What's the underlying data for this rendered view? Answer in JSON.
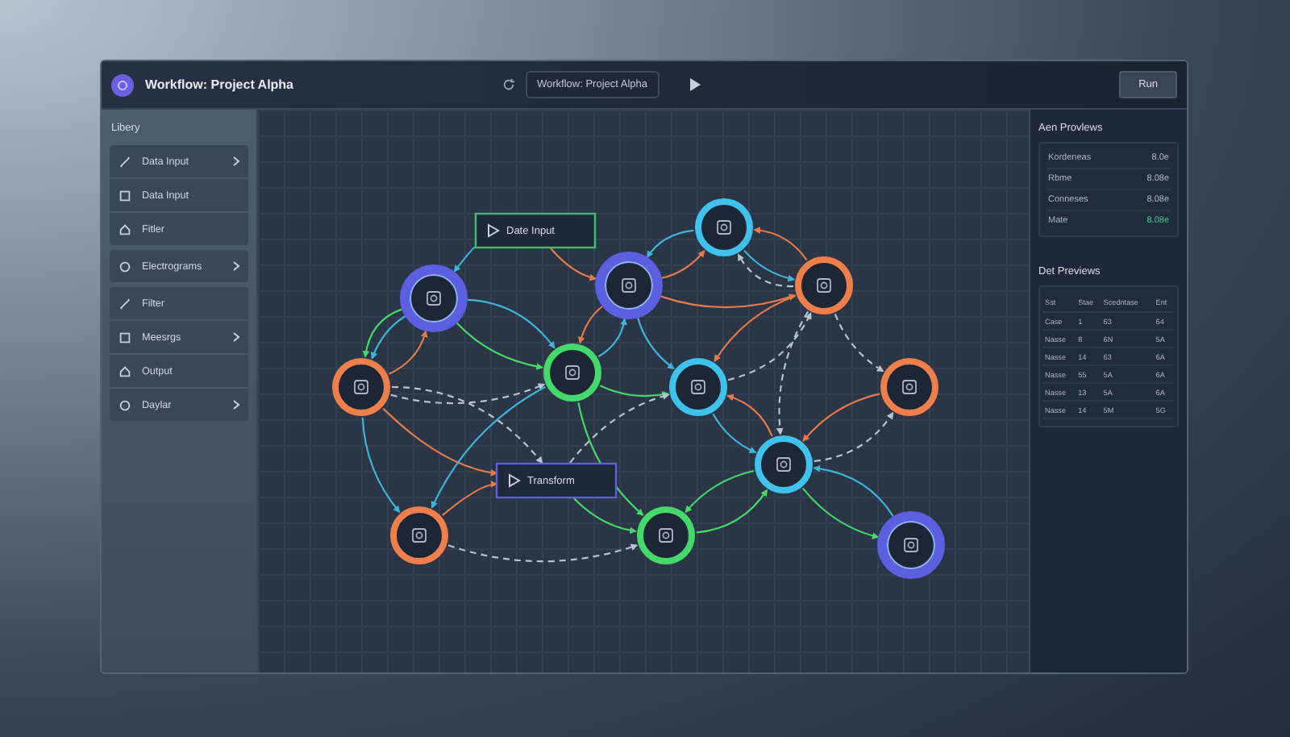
{
  "window": {
    "title": "Workflow: Project Alpha"
  },
  "toolbar": {
    "workflow": "Workflow: Project Alpha",
    "run": "Run"
  },
  "sidebar": {
    "title": "Libery",
    "groups": [
      {
        "items": [
          {
            "label": "Data Input",
            "expandable": true
          },
          {
            "label": "Data Input",
            "expandable": false
          },
          {
            "label": "Fitler",
            "expandable": false
          }
        ]
      },
      {
        "items": [
          {
            "label": "Electrograms",
            "expandable": true
          }
        ]
      },
      {
        "items": [
          {
            "label": "Filter",
            "expandable": false
          },
          {
            "label": "Meesrgs",
            "expandable": true
          },
          {
            "label": "Output",
            "expandable": false
          },
          {
            "label": "Daylar",
            "expandable": true
          }
        ]
      }
    ]
  },
  "canvas": {
    "nodes": [
      {
        "kind": "block",
        "label": "Date Input",
        "color": "#3fbf6a"
      },
      {
        "kind": "circle",
        "color": "#5b5fe0"
      },
      {
        "kind": "circle",
        "color": "#5b5fe0"
      },
      {
        "kind": "circle",
        "color": "#3fc3ec"
      },
      {
        "kind": "circle",
        "color": "#ee7f4b"
      },
      {
        "kind": "circle",
        "color": "#ee7f4b"
      },
      {
        "kind": "circle",
        "color": "#45d86a"
      },
      {
        "kind": "circle",
        "color": "#3fc3ec"
      },
      {
        "kind": "circle",
        "color": "#ee7f4b"
      },
      {
        "kind": "circle",
        "color": "#3fc3ec"
      },
      {
        "kind": "block",
        "label": "Transform",
        "color": "#5b5fe0"
      },
      {
        "kind": "circle",
        "color": "#ee7f4b"
      },
      {
        "kind": "circle",
        "color": "#45d86a"
      },
      {
        "kind": "circle",
        "color": "#5b5fe0"
      }
    ],
    "edges": [
      {
        "color": "#3fb4d8",
        "dashed": false
      },
      {
        "color": "#e67a4a",
        "dashed": false
      },
      {
        "color": "#3fb4d8",
        "dashed": false
      },
      {
        "color": "#e67a4a",
        "dashed": false
      },
      {
        "color": "#45d86a",
        "dashed": false
      },
      {
        "color": "#45d86a",
        "dashed": false
      },
      {
        "color": "#3fb4d8",
        "dashed": false
      },
      {
        "color": "#e67a4a",
        "dashed": false
      },
      {
        "color": "#3fb4d8",
        "dashed": false
      },
      {
        "color": "#e67a4a",
        "dashed": false
      },
      {
        "color": "#e67a4a",
        "dashed": false
      },
      {
        "color": "#3fb4d8",
        "dashed": false
      },
      {
        "color": "#3fb4d8",
        "dashed": false
      },
      {
        "color": "#3fb4d8",
        "dashed": false
      },
      {
        "color": "#e67a4a",
        "dashed": false
      },
      {
        "color": "#b8c2d0",
        "dashed": true
      },
      {
        "color": "#e67a4a",
        "dashed": false
      },
      {
        "color": "#b8c2d0",
        "dashed": true
      },
      {
        "color": "#b8c2d0",
        "dashed": true
      },
      {
        "color": "#b8c2d0",
        "dashed": true
      },
      {
        "color": "#b8c2d0",
        "dashed": true
      },
      {
        "color": "#e67a4a",
        "dashed": false
      },
      {
        "color": "#b8c2d0",
        "dashed": true
      },
      {
        "color": "#3fb4d8",
        "dashed": false
      },
      {
        "color": "#3fb4d8",
        "dashed": false
      },
      {
        "color": "#45d86a",
        "dashed": false
      },
      {
        "color": "#45d86a",
        "dashed": false
      },
      {
        "color": "#b8c2d0",
        "dashed": true
      },
      {
        "color": "#45d86a",
        "dashed": false
      },
      {
        "color": "#e67a4a",
        "dashed": false
      },
      {
        "color": "#b8c2d0",
        "dashed": true
      },
      {
        "color": "#3fb4d8",
        "dashed": false
      },
      {
        "color": "#e67a4a",
        "dashed": false
      },
      {
        "color": "#e67a4a",
        "dashed": false
      },
      {
        "color": "#b8c2d0",
        "dashed": true
      },
      {
        "color": "#45d86a",
        "dashed": false
      },
      {
        "color": "#45d86a",
        "dashed": false
      },
      {
        "color": "#45d86a",
        "dashed": false
      },
      {
        "color": "#3fb4d8",
        "dashed": false
      }
    ]
  },
  "previews": {
    "title": "Aen Provlews",
    "rows": [
      {
        "name": "Kordeneas",
        "value": "8.0e",
        "color": "#aab6c4"
      },
      {
        "name": "Rbme",
        "value": "8.08e",
        "color": "#aab6c4"
      },
      {
        "name": "Conneses",
        "value": "8.08e",
        "color": "#aab6c4"
      },
      {
        "name": "Mate",
        "value": "8.08e",
        "color": "#45c88a"
      }
    ]
  },
  "data_previews": {
    "title": "Det Previews",
    "columns": [
      "Sst",
      "Stae",
      "Scedntase",
      "Ent"
    ],
    "rows": [
      [
        "Case",
        "1",
        "63",
        "64"
      ],
      [
        "Nasse",
        "8",
        "6N",
        "5A"
      ],
      [
        "Nasse",
        "14",
        "63",
        "6A"
      ],
      [
        "Nasse",
        "55",
        "5A",
        "6A"
      ],
      [
        "Nasse",
        "13",
        "5A",
        "6A"
      ],
      [
        "Nasse",
        "14",
        "5M",
        "5G"
      ]
    ]
  }
}
